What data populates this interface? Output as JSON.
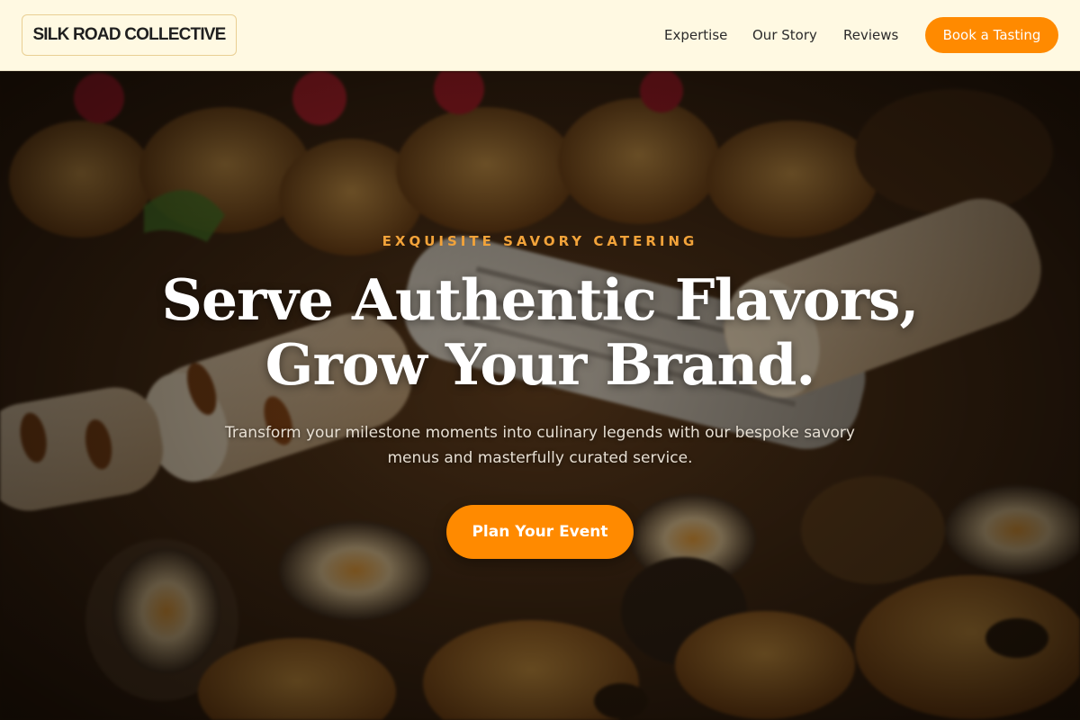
{
  "header": {
    "logo": "SILK ROAD COLLECTIVE",
    "nav": [
      "Expertise",
      "Our Story",
      "Reviews"
    ],
    "cta": "Book a Tasting"
  },
  "hero": {
    "eyebrow": "EXQUISITE SAVORY CATERING",
    "headline_line1": "Serve Authentic Flavors,",
    "headline_line2": "Grow Your Brand.",
    "subtitle": "Transform your milestone moments into culinary legends with our bespoke savory menus and masterfully curated service.",
    "cta": "Plan Your Event",
    "background_image": "food-platter-photo"
  },
  "colors": {
    "accent": "#FF8A00",
    "header_bg": "#FFF9E2",
    "eyebrow": "#F2A33A",
    "headline": "#FFFFFF"
  }
}
